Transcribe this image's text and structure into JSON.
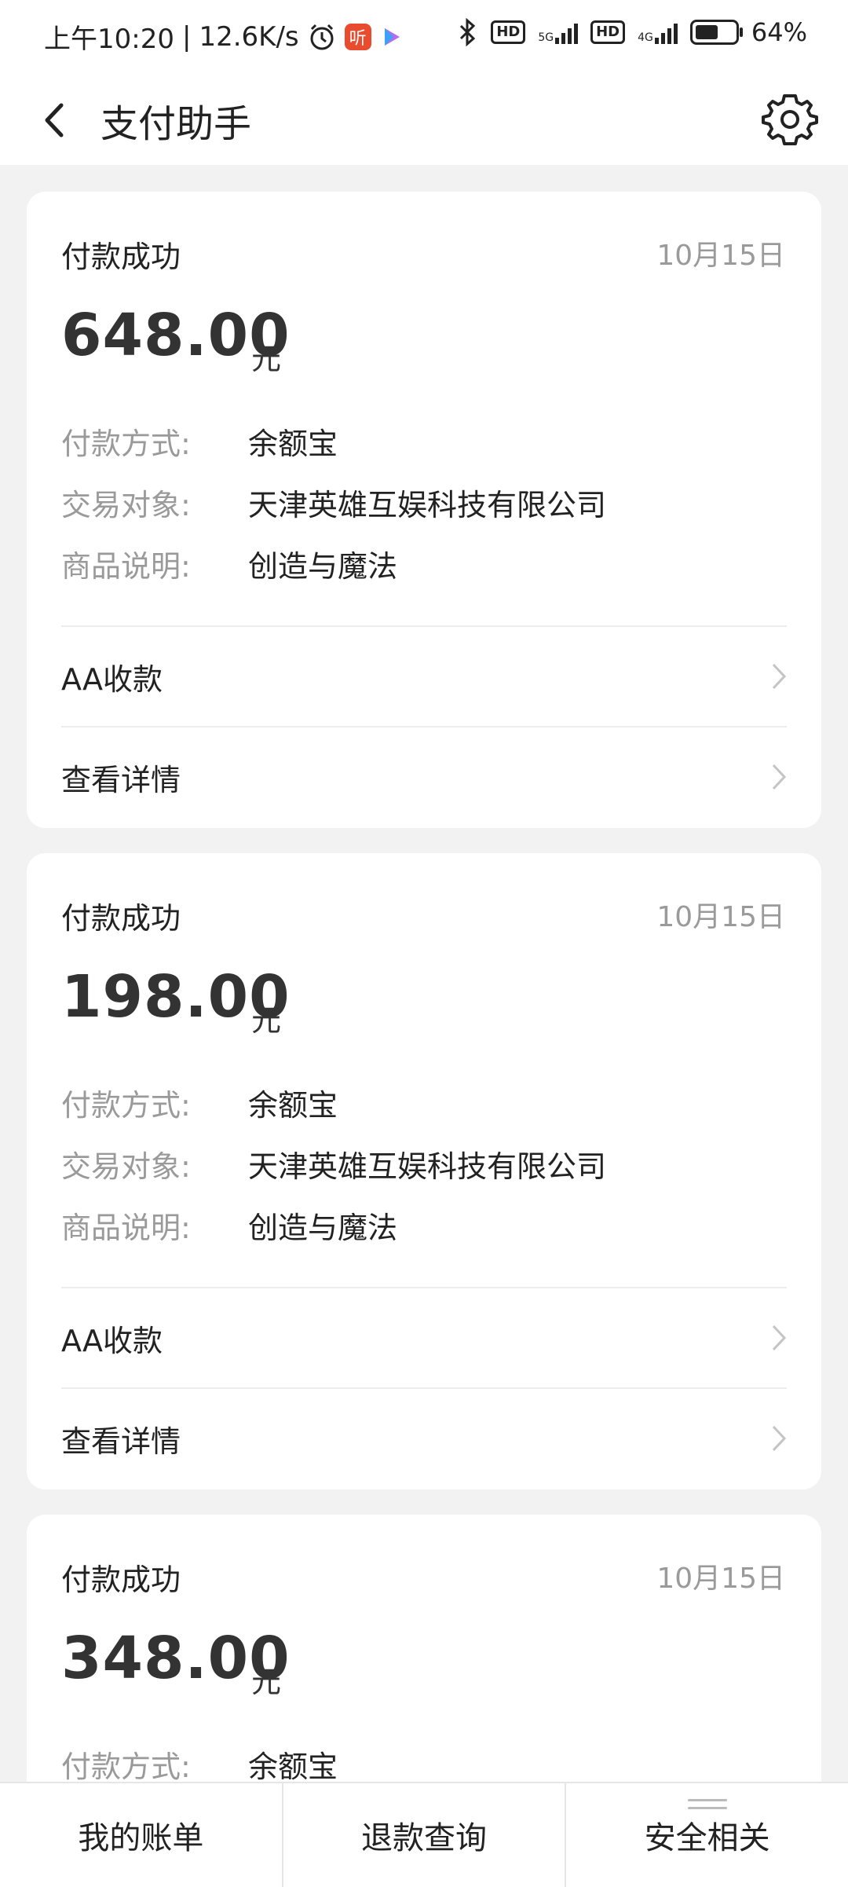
{
  "status_bar": {
    "time": "上午10:20",
    "speed": "12.6K/s",
    "network1": "5G",
    "network2": "4G",
    "hd": "HD",
    "battery": "64%",
    "app_badge": "听"
  },
  "header": {
    "title": "支付助手"
  },
  "cards": [
    {
      "status": "付款成功",
      "date": "10月15日",
      "amount": "648.00",
      "unit": "元",
      "rows": [
        {
          "label": "付款方式:",
          "value": "余额宝"
        },
        {
          "label": "交易对象:",
          "value": "天津英雄互娱科技有限公司"
        },
        {
          "label": "商品说明:",
          "value": "创造与魔法"
        }
      ],
      "links": [
        "AA收款",
        "查看详情"
      ]
    },
    {
      "status": "付款成功",
      "date": "10月15日",
      "amount": "198.00",
      "unit": "元",
      "rows": [
        {
          "label": "付款方式:",
          "value": "余额宝"
        },
        {
          "label": "交易对象:",
          "value": "天津英雄互娱科技有限公司"
        },
        {
          "label": "商品说明:",
          "value": "创造与魔法"
        }
      ],
      "links": [
        "AA收款",
        "查看详情"
      ]
    },
    {
      "status": "付款成功",
      "date": "10月15日",
      "amount": "348.00",
      "unit": "元",
      "rows": [
        {
          "label": "付款方式:",
          "value": "余额宝"
        }
      ]
    }
  ],
  "tabs": [
    "我的账单",
    "退款查询",
    "安全相关"
  ],
  "colors": {
    "background": "#f2f2f2",
    "card": "#ffffff",
    "label_gray": "#9a9a9a",
    "text": "#222222"
  }
}
